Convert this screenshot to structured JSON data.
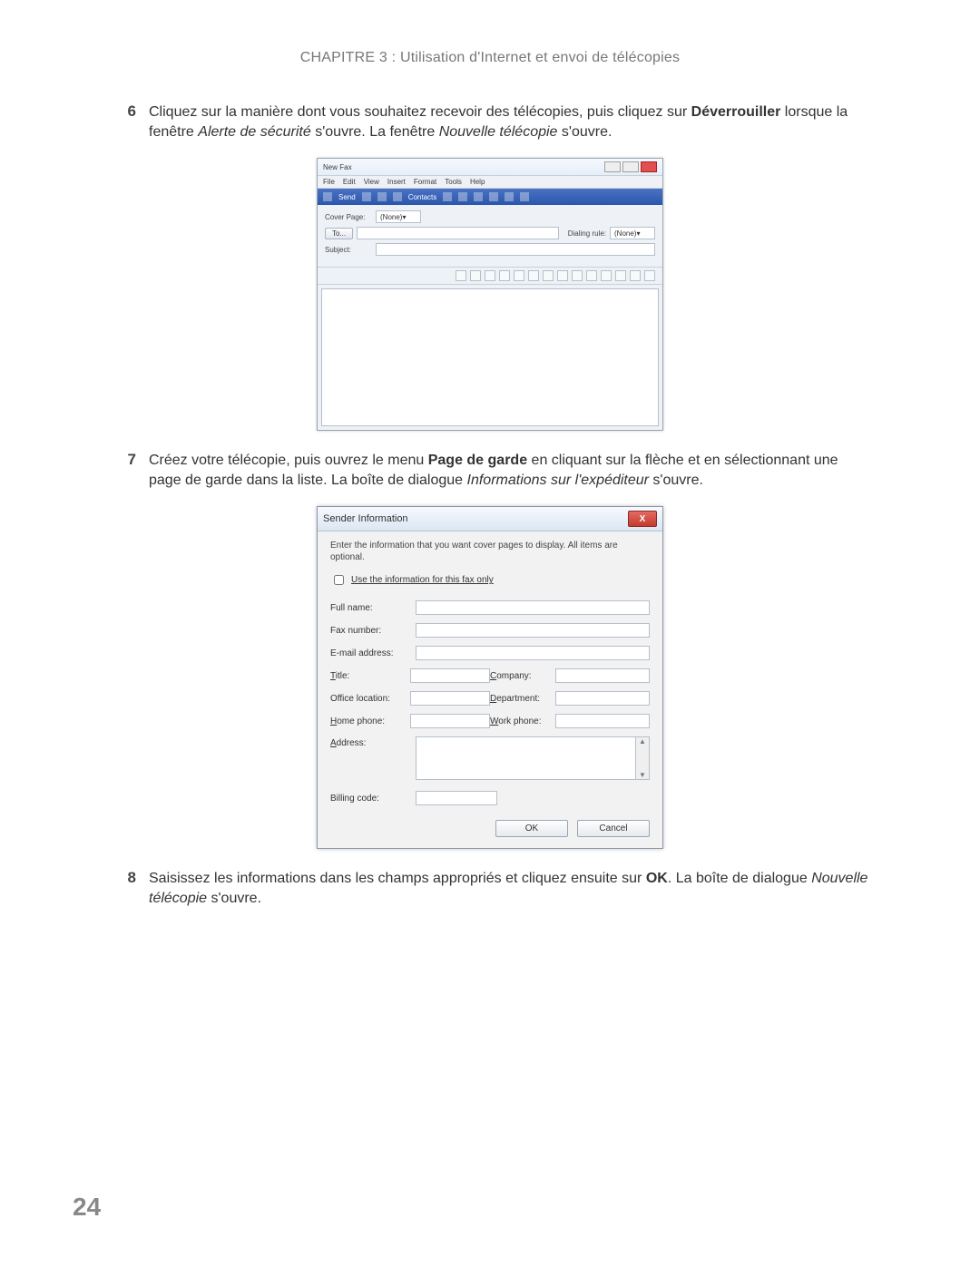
{
  "header": "CHAPITRE 3 : Utilisation d'Internet et envoi de télécopies",
  "page_number": "24",
  "steps": {
    "s6": {
      "num": "6",
      "p1_a": "Cliquez sur la manière dont vous souhaitez recevoir des télécopies, puis cliquez sur ",
      "p1_bold": "Déverrouiller",
      "p1_b": " lorsque la fenêtre ",
      "p1_ital1": "Alerte de sécurité",
      "p1_c": " s'ouvre. La fenêtre ",
      "p1_ital2": "Nouvelle télécopie",
      "p1_d": " s'ouvre."
    },
    "s7": {
      "num": "7",
      "p1_a": "Créez votre télécopie, puis ouvrez le menu ",
      "p1_bold": "Page de garde",
      "p1_b": " en cliquant sur la flèche et en sélectionnant une page de garde dans la liste. La boîte de dialogue ",
      "p1_ital": "Informations sur l'expéditeur",
      "p1_c": " s'ouvre."
    },
    "s8": {
      "num": "8",
      "p1_a": "Saisissez les informations dans les champs appropriés et cliquez ensuite sur ",
      "p1_bold": "OK",
      "p1_b": ". La boîte de dialogue ",
      "p1_ital": "Nouvelle télécopie",
      "p1_c": " s'ouvre."
    }
  },
  "fax": {
    "title": "New Fax",
    "menu": {
      "file": "File",
      "edit": "Edit",
      "view": "View",
      "insert": "Insert",
      "format": "Format",
      "tools": "Tools",
      "help": "Help"
    },
    "toolbar": {
      "send": "Send",
      "contacts": "Contacts"
    },
    "cover_page_label": "Cover Page:",
    "cover_page_value": "(None)",
    "to_btn": "To...",
    "dialing_label": "Dialing rule:",
    "dialing_value": "(None)",
    "subject_label": "Subject:"
  },
  "sender": {
    "title": "Sender Information",
    "desc": "Enter the information that you want cover pages to display. All items are optional.",
    "check": "Use the information for this fax only",
    "full_name": "Full name:",
    "fax_number": "Fax number:",
    "email": "E-mail address:",
    "title_lbl": "Title:",
    "company": "Company:",
    "office": "Office location:",
    "department": "Department:",
    "home_phone": "Home phone:",
    "work_phone": "Work phone:",
    "address": "Address:",
    "billing": "Billing code:",
    "ok": "OK",
    "cancel": "Cancel"
  }
}
